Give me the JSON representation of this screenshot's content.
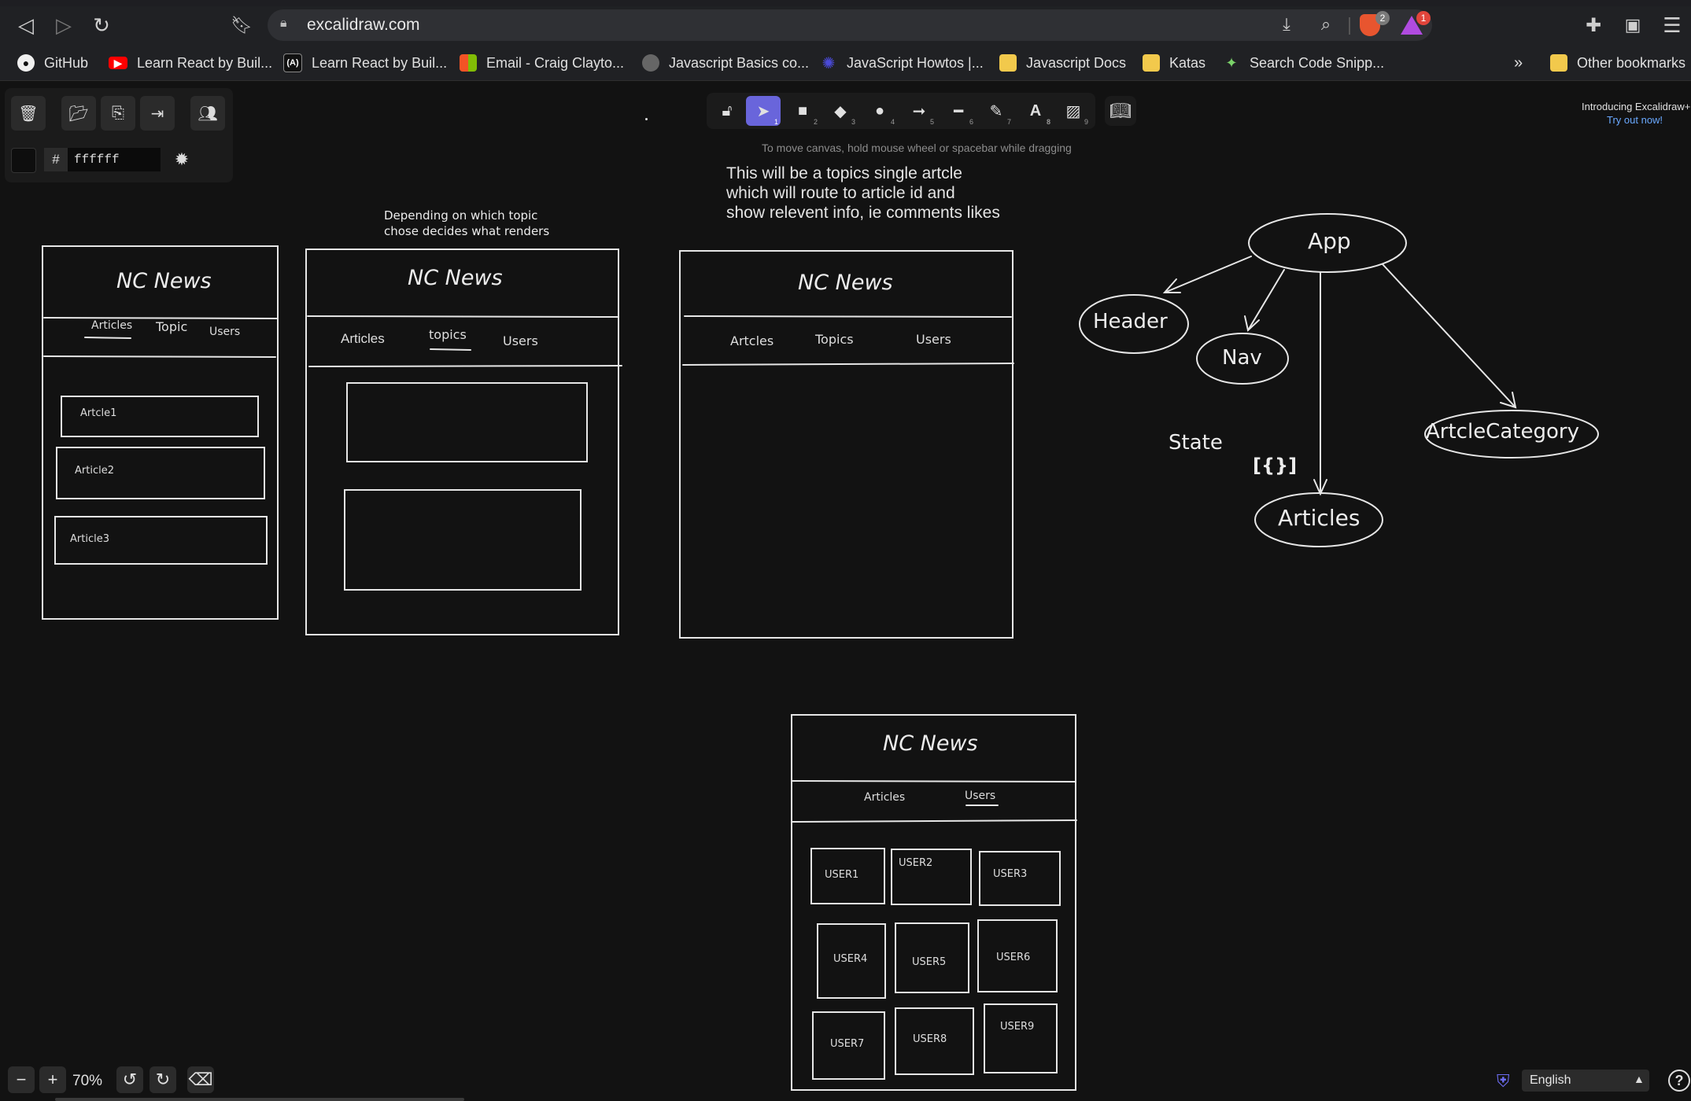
{
  "browser": {
    "url": "excalidraw.com",
    "shields_count": "2",
    "rewards_count": "1",
    "bookmarks": [
      {
        "label": "GitHub",
        "icon": "github-icon"
      },
      {
        "label": "Learn React by Buil...",
        "icon": "youtube-icon"
      },
      {
        "label": "Learn React by Buil...",
        "icon": "freecodecamp-icon"
      },
      {
        "label": "Email - Craig Clayto...",
        "icon": "microsoft-icon"
      },
      {
        "label": "Javascript Basics co...",
        "icon": "globe-icon"
      },
      {
        "label": "JavaScript Howtos |...",
        "icon": "gear-icon"
      },
      {
        "label": "Javascript Docs",
        "icon": "folder-icon"
      },
      {
        "label": "Katas",
        "icon": "folder-icon"
      },
      {
        "label": "Search Code Snipp...",
        "icon": "snippet-icon"
      }
    ],
    "overflow": "»",
    "other_bookmarks": "Other bookmarks"
  },
  "editor": {
    "color_hash": "#",
    "color_hex": "ffffff",
    "canvas_hint": "To move canvas, hold mouse wheel or spacebar while dragging",
    "promo_title": "Introducing Excalidraw+",
    "promo_link": "Try out now!",
    "tool_keys": [
      "1",
      "2",
      "3",
      "4",
      "5",
      "6",
      "7",
      "8",
      "9"
    ],
    "zoom_level": "70%",
    "language": "English",
    "accent_color": "#6965db"
  },
  "canvas": {
    "topics_note": "This will be a topics single artcle\nwhich will route to article id and\nshow relevent info, ie comments likes",
    "depending_note": "Depending on which topic\nchose decides what renders",
    "wire1": {
      "title": "NC News",
      "tabs": [
        "Articles",
        "Topic",
        "Users"
      ],
      "items": [
        "Artcle1",
        "Article2",
        "Article3"
      ]
    },
    "wire2": {
      "title": "NC News",
      "tabs": [
        "Articles",
        "topics",
        "Users"
      ]
    },
    "wire3": {
      "title": "NC News",
      "tabs": [
        "Artcles",
        "Topics",
        "Users"
      ]
    },
    "wire4": {
      "title": "NC News",
      "tabs": [
        "Articles",
        "Users"
      ],
      "users": [
        "USER1",
        "USER2",
        "USER3",
        "USER4",
        "USER5",
        "USER6",
        "USER7",
        "USER8",
        "USER9"
      ]
    },
    "tree": {
      "root": "App",
      "children": [
        "Header",
        "Nav",
        "ArtcleCategory",
        "Articles"
      ],
      "state_label": "State",
      "state_value": "[{}]"
    }
  }
}
